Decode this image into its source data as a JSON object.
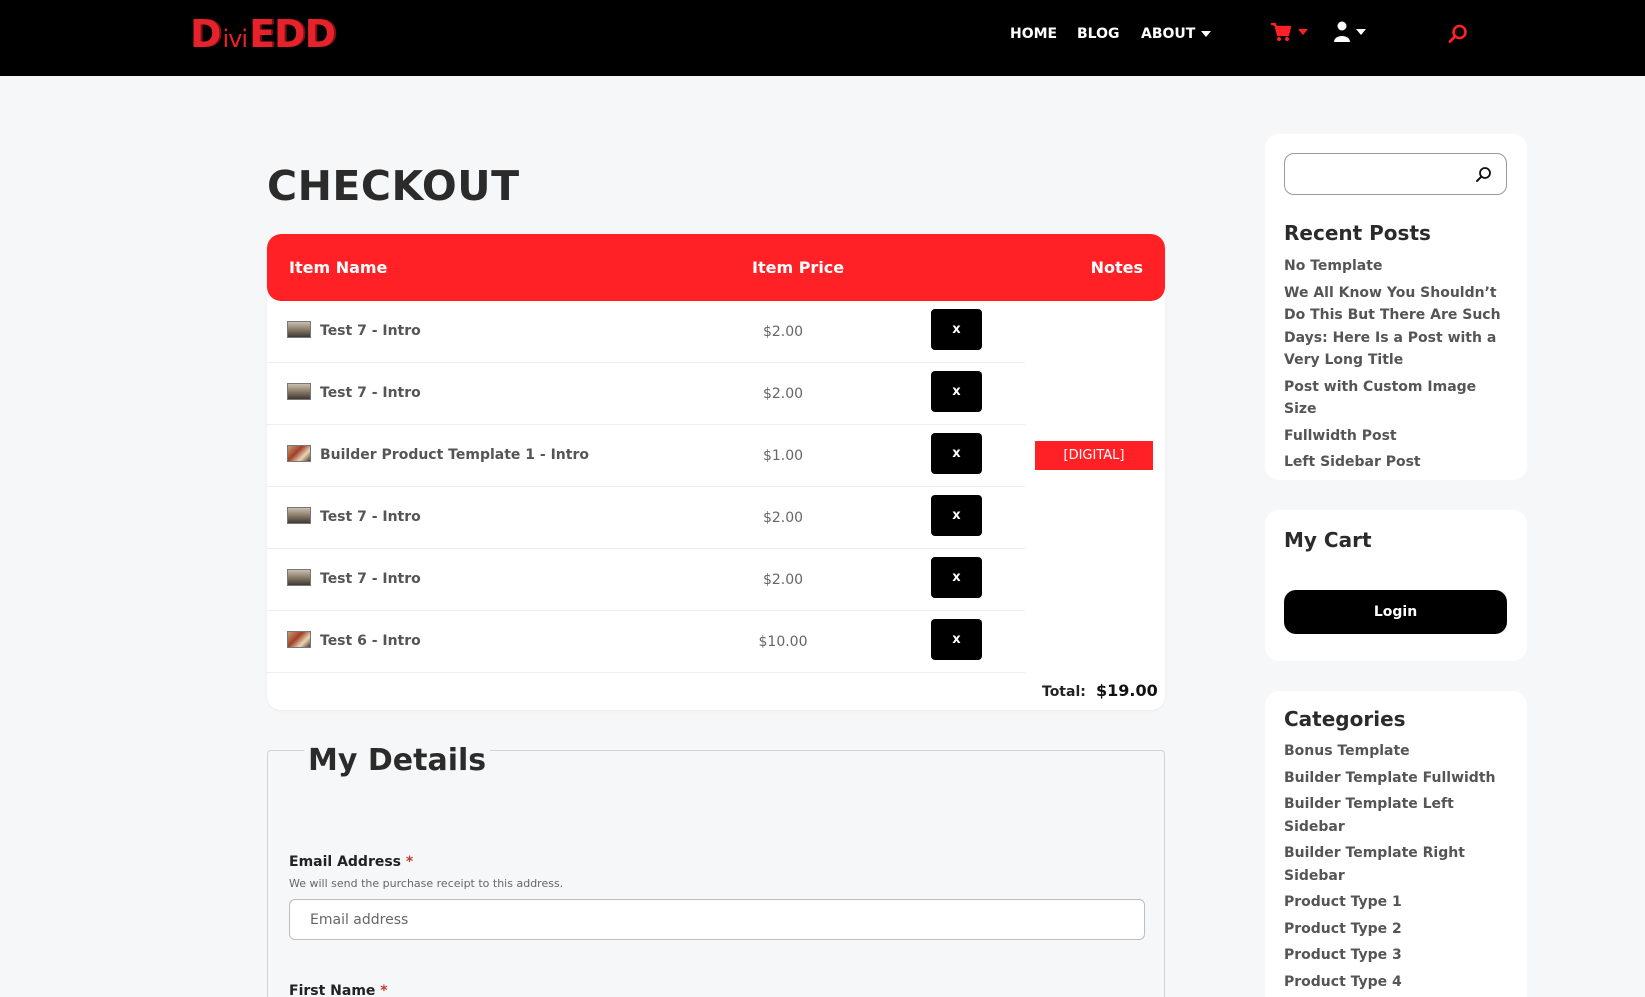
{
  "header": {
    "logo": {
      "part1": "Divi",
      "part1_main": "D",
      "part1_small": "ivi",
      "part2": "EDD"
    },
    "nav": [
      {
        "label": "HOME"
      },
      {
        "label": "BLOG"
      },
      {
        "label": "ABOUT"
      }
    ],
    "icons": [
      "cart-icon",
      "user-icon",
      "search-icon"
    ],
    "accent_color": "#ff2126"
  },
  "main": {
    "title": "CHECKOUT",
    "cart": {
      "columns": [
        "Item Name",
        "Item Price",
        "Notes"
      ],
      "items": [
        {
          "name": "Test 7 - Intro",
          "price": "$2.00",
          "remove": "x"
        },
        {
          "name": "Test 7 - Intro",
          "price": "$2.00",
          "remove": "x"
        },
        {
          "name": "Builder Product Template 1 - Intro",
          "price": "$1.00",
          "remove": "x",
          "note": "[DIGITAL]"
        },
        {
          "name": "Test 7 - Intro",
          "price": "$2.00",
          "remove": "x"
        },
        {
          "name": "Test 7 - Intro",
          "price": "$2.00",
          "remove": "x"
        },
        {
          "name": "Test 6 - Intro",
          "price": "$10.00",
          "remove": "x"
        }
      ],
      "total_label": "Total:",
      "total_value": "$19.00"
    },
    "details": {
      "title": "My Details",
      "email_label": "Email Address",
      "required_mark": "*",
      "email_help": "We will send the purchase receipt to this address.",
      "email_placeholder": "Email address",
      "first_name_label": "First Name"
    }
  },
  "sidebar": {
    "recent_posts": {
      "title": "Recent Posts",
      "items": [
        "No Template",
        "We All Know You Shouldn’t Do This But There Are Such Days: Here Is a Post with a Very Long Title",
        "Post with Custom Image Size",
        "Fullwidth Post",
        "Left Sidebar Post"
      ]
    },
    "cart": {
      "title": "My Cart",
      "login_label": "Login"
    },
    "categories": {
      "title": "Categories",
      "items": [
        "Bonus Template",
        "Builder Template Fullwidth",
        "Builder Template Left Sidebar",
        "Builder Template Right Sidebar",
        "Product Type 1",
        "Product Type 2",
        "Product Type 3",
        "Product Type 4"
      ]
    }
  }
}
